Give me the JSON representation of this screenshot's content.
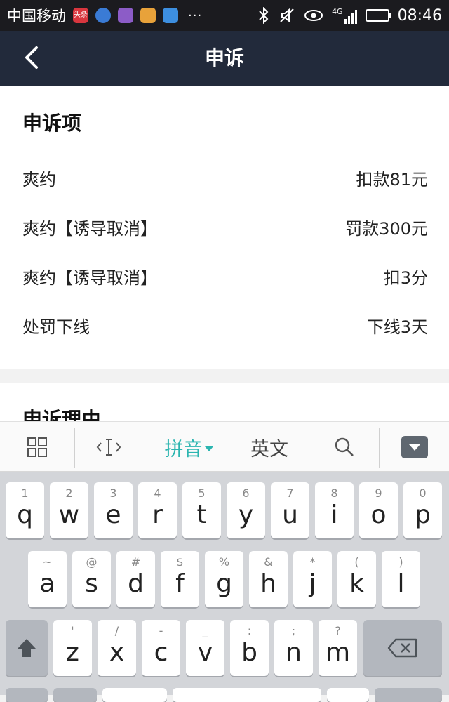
{
  "status_bar": {
    "carrier": "中国移动",
    "app_toutiao": "头条",
    "dots": "···",
    "network": "4G",
    "time": "08:46"
  },
  "header": {
    "title": "申诉"
  },
  "appeal_items": {
    "section_title": "申诉项",
    "rows": [
      {
        "label": "爽约",
        "value": "扣款81元"
      },
      {
        "label": "爽约【诱导取消】",
        "value": "罚款300元"
      },
      {
        "label": "爽约【诱导取消】",
        "value": "扣3分"
      },
      {
        "label": "处罚下线",
        "value": "下线3天"
      }
    ]
  },
  "appeal_reason": {
    "section_title": "申诉理由"
  },
  "ime_toolbar": {
    "pinyin_label": "拼音",
    "english_label": "英文",
    "accent_color": "#2bb5b0"
  },
  "keyboard": {
    "row1": [
      {
        "ch": "q",
        "hint": "1"
      },
      {
        "ch": "w",
        "hint": "2"
      },
      {
        "ch": "e",
        "hint": "3"
      },
      {
        "ch": "r",
        "hint": "4"
      },
      {
        "ch": "t",
        "hint": "5"
      },
      {
        "ch": "y",
        "hint": "6"
      },
      {
        "ch": "u",
        "hint": "7"
      },
      {
        "ch": "i",
        "hint": "8"
      },
      {
        "ch": "o",
        "hint": "9"
      },
      {
        "ch": "p",
        "hint": "0"
      }
    ],
    "row2": [
      {
        "ch": "a",
        "hint": "~"
      },
      {
        "ch": "s",
        "hint": "@"
      },
      {
        "ch": "d",
        "hint": "#"
      },
      {
        "ch": "f",
        "hint": "$"
      },
      {
        "ch": "g",
        "hint": "%"
      },
      {
        "ch": "h",
        "hint": "&"
      },
      {
        "ch": "j",
        "hint": "*"
      },
      {
        "ch": "k",
        "hint": "("
      },
      {
        "ch": "l",
        "hint": ")"
      }
    ],
    "row3": [
      {
        "ch": "z",
        "hint": "'"
      },
      {
        "ch": "x",
        "hint": "/"
      },
      {
        "ch": "c",
        "hint": "-"
      },
      {
        "ch": "v",
        "hint": "_"
      },
      {
        "ch": "b",
        "hint": ":"
      },
      {
        "ch": "n",
        "hint": ";"
      },
      {
        "ch": "m",
        "hint": "?"
      }
    ]
  }
}
